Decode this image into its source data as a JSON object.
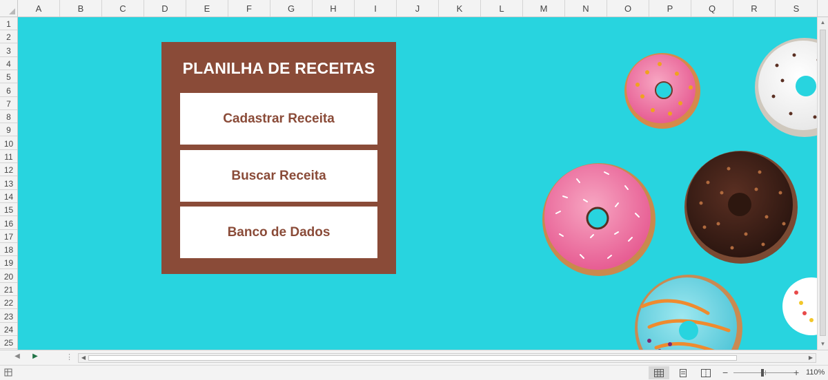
{
  "spreadsheet": {
    "columns": [
      "A",
      "B",
      "C",
      "D",
      "E",
      "F",
      "G",
      "H",
      "I",
      "J",
      "K",
      "L",
      "M",
      "N",
      "O",
      "P",
      "Q",
      "R",
      "S"
    ],
    "rows": [
      "1",
      "2",
      "3",
      "4",
      "5",
      "6",
      "7",
      "8",
      "9",
      "10",
      "11",
      "12",
      "13",
      "14",
      "15",
      "16",
      "17",
      "18",
      "19",
      "20",
      "21",
      "22",
      "23",
      "24",
      "25"
    ]
  },
  "panel": {
    "title": "PLANILHA DE RECEITAS",
    "buttons": [
      {
        "label": "Cadastrar Receita"
      },
      {
        "label": "Buscar Receita"
      },
      {
        "label": "Banco de Dados"
      }
    ]
  },
  "statusbar": {
    "zoom_label": "110%",
    "zoom_minus": "−",
    "zoom_plus": "+"
  },
  "colors": {
    "sheet_background": "#28d4df",
    "panel_background": "#8a4b38",
    "button_text": "#8a4b38"
  },
  "icons": {
    "corner": "select-all-triangle",
    "status": "cell-mode-icon",
    "views": [
      "normal-view-icon",
      "page-layout-icon",
      "page-break-preview-icon"
    ]
  }
}
